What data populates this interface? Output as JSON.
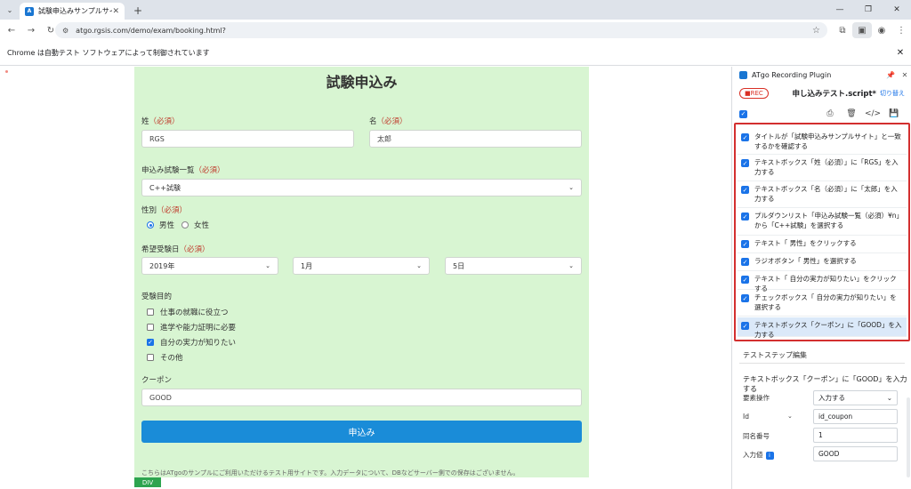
{
  "browser": {
    "tab_title": "試験申込みサンプルサイト",
    "url": "atgo.rgsis.com/demo/exam/booking.html?",
    "infobar_message": "Chrome は自動テスト ソフトウェアによって制御されています"
  },
  "form": {
    "title": "試験申込み",
    "required_mark": "（必須）",
    "last_name_label": "姓",
    "last_name_value": "RGS",
    "first_name_label": "名",
    "first_name_value": "太郎",
    "exam_list_label": "申込み試験一覧",
    "exam_value": "C++試験",
    "gender_label": "性別",
    "gender_male": "男性",
    "gender_female": "女性",
    "date_label": "希望受験日",
    "year_value": "2019年",
    "month_value": "1月",
    "day_value": "5日",
    "purpose_label": "受験目的",
    "purposes": [
      {
        "label": "仕事の就職に役立つ",
        "checked": false
      },
      {
        "label": "進学や能力証明に必要",
        "checked": false
      },
      {
        "label": "自分の実力が知りたい",
        "checked": true
      },
      {
        "label": "その他",
        "checked": false
      }
    ],
    "coupon_label": "クーポン",
    "coupon_value": "GOOD",
    "submit_label": "申込み",
    "footnote": "こちらはATgoのサンプルにご利用いただけるテスト用サイトです。入力データについて、DBなどサーバー側での保存はございません。",
    "div_badge": "DIV"
  },
  "plugin": {
    "name": "ATgo Recording Plugin",
    "rec_label": "■REC",
    "script_name": "申し込みテスト.script*",
    "switch_label": "切り替え",
    "steps": [
      "タイトルが「試験申込みサンプルサイト」と一致するかを確認する",
      "テキストボックス「姓（必須）」に「RGS」を入力する",
      "テキストボックス「名（必須）」に「太郎」を入力する",
      "プルダウンリスト「申込み試験一覧（必須）¥n」から「C++試験」を選択する",
      "テキスト「 男性」をクリックする",
      "ラジオボタン「 男性」を選択する",
      "テキスト「 自分の実力が知りたい」をクリックする",
      "チェックボックス「 自分の実力が知りたい」を選択する",
      "テキストボックス「クーポン」に「GOOD」を入力する"
    ],
    "edit_title": "テストステップ編集",
    "edit_description": "テキストボックス「クーポン」に「GOOD」を入力する",
    "props": {
      "operation_label": "要素操作",
      "operation_value": "入力する",
      "id_label": "Id",
      "id_value": "id_coupon",
      "index_label": "同名番号",
      "index_value": "1",
      "input_label": "入力値",
      "input_value": "GOOD"
    }
  }
}
